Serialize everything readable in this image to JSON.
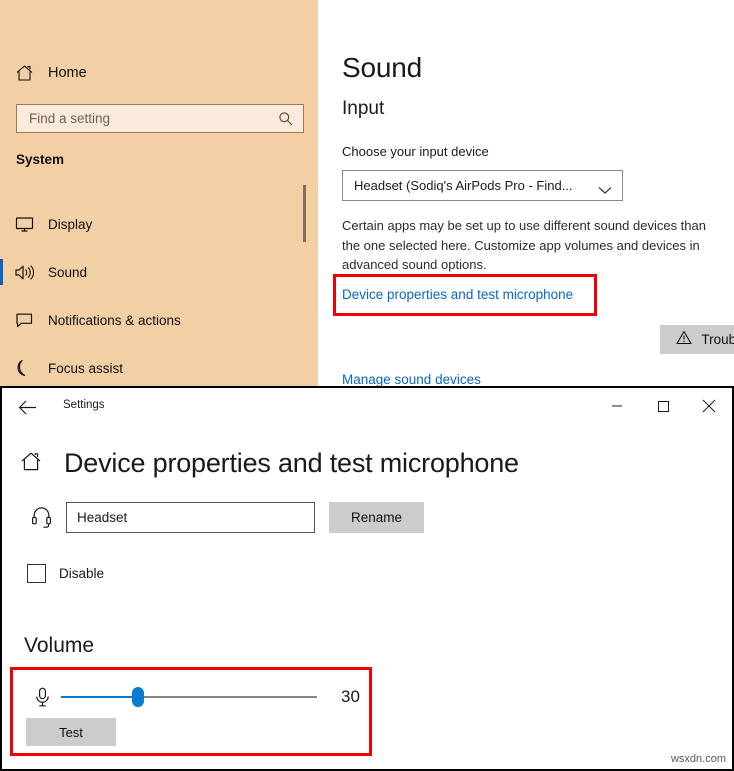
{
  "window_back": {
    "titlebar": {
      "back_icon": "back-arrow-icon",
      "title": "Settings",
      "minimize": "minimize-icon",
      "maximize": "maximize-icon",
      "close": "close-icon"
    },
    "sidebar": {
      "home_label": "Home",
      "home_icon": "home-icon",
      "search_placeholder": "Find a setting",
      "search_icon": "search-icon",
      "section_label": "System",
      "items": [
        {
          "label": "Display",
          "icon": "monitor-icon",
          "selected": false
        },
        {
          "label": "Sound",
          "icon": "speaker-icon",
          "selected": true
        },
        {
          "label": "Notifications & actions",
          "icon": "chat-bubble-icon",
          "selected": false
        },
        {
          "label": "Focus assist",
          "icon": "moon-icon",
          "selected": false
        }
      ]
    },
    "main": {
      "page_title": "Sound",
      "section_title": "Input",
      "device_label": "Choose your input device",
      "device_value": "Headset (Sodiq's AirPods Pro - Find...",
      "dropdown_icon": "chevron-down-icon",
      "description": "Certain apps may be set up to use different sound devices than the one selected here. Customize app volumes and devices in advanced sound options.",
      "device_properties_link": "Device properties and test microphone",
      "troubleshoot_label": "Troubleshoot",
      "troubleshoot_icon": "warning-triangle-icon",
      "manage_devices_link": "Manage sound devices"
    }
  },
  "window_front": {
    "titlebar": {
      "back_icon": "back-arrow-icon",
      "title": "Settings",
      "minimize": "minimize-icon",
      "maximize": "maximize-icon",
      "close": "close-icon"
    },
    "page_title": "Device properties and test microphone",
    "home_icon": "home-icon",
    "device": {
      "icon": "headset-icon",
      "name_value": "Headset",
      "name_placeholder": "Headset",
      "rename_label": "Rename",
      "disable_label": "Disable",
      "disable_checked": false
    },
    "volume": {
      "heading": "Volume",
      "mic_icon": "microphone-icon",
      "level": "30",
      "percent": 30,
      "test_label": "Test"
    }
  },
  "annotations": {
    "highlight_color": "#f50000",
    "accent_color": "#0a7ad1",
    "link_color": "#0a66c2",
    "sidebar_color": "#f2cfa4"
  },
  "watermark": "wsxdn.com"
}
